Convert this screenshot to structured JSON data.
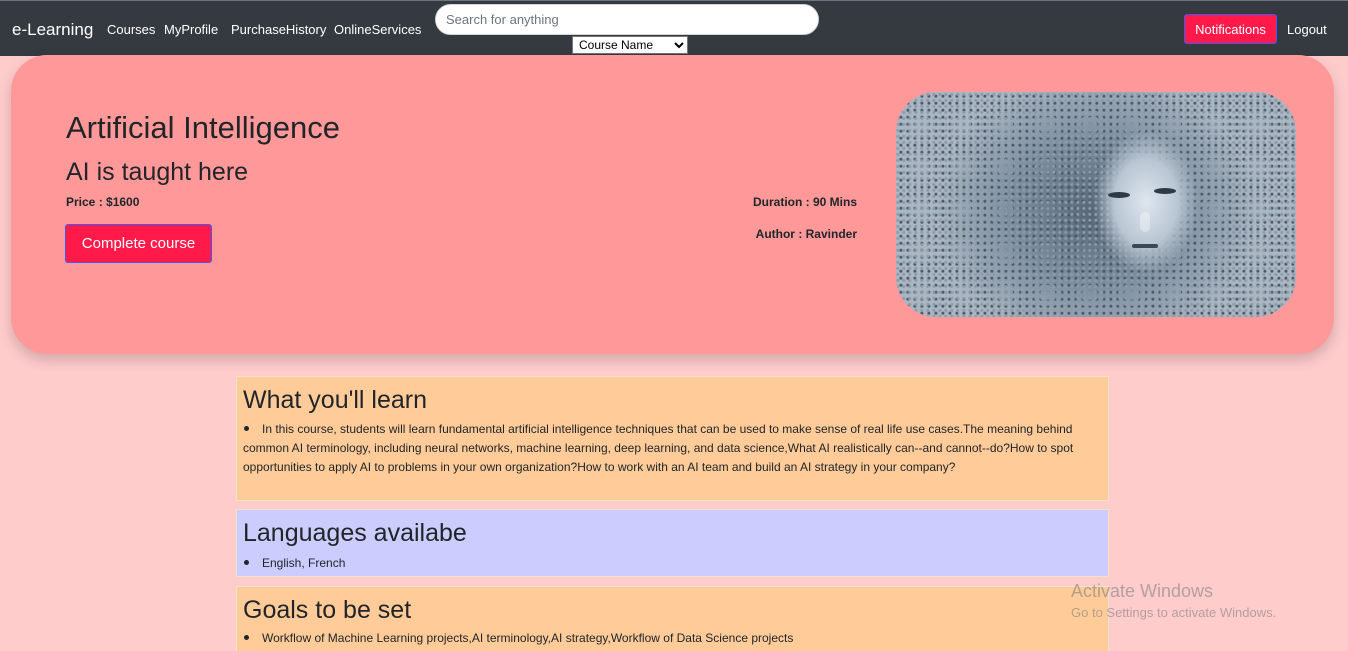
{
  "navbar": {
    "brand": "e-Learning",
    "links": [
      "Courses",
      "MyProfile",
      "PurchaseHistory",
      "OnlineServices"
    ],
    "search_placeholder": "Search for anything",
    "search_filter": "Course Name",
    "notifications_label": "Notifications",
    "logout_label": "Logout"
  },
  "course": {
    "title": "Artificial Intelligence",
    "subtitle": "AI is taught here",
    "price": "Price : $1600",
    "duration": "Duration : 90 Mins",
    "author": "Author : Ravinder",
    "complete_button": "Complete course"
  },
  "sections": {
    "learn": {
      "title": "What you'll learn",
      "items": [
        "In this course, students will learn fundamental artificial intelligence techniques that can be used to make sense of real life use cases.The meaning behind common AI terminology, including neural networks, machine learning, deep learning, and data science,What AI realistically can--and cannot--do?How to spot opportunities to apply AI to problems in your own organization?How to work with an AI team and build an AI strategy in your company?"
      ]
    },
    "languages": {
      "title": "Languages availabe",
      "items": [
        "English, French"
      ]
    },
    "goals": {
      "title": "Goals to be set",
      "items": [
        "Workflow of Machine Learning projects,AI terminology,AI strategy,Workflow of Data Science projects"
      ]
    }
  },
  "watermark": {
    "title": "Activate Windows",
    "subtitle": "Go to Settings to activate Windows."
  },
  "colors": {
    "navbar": "#343a40",
    "page_bg": "#ffcccc",
    "hero_bg": "#ff9999",
    "accent_button": "#ff1a4a",
    "section_orange": "#ffcc99",
    "section_lavender": "#ccccff"
  }
}
